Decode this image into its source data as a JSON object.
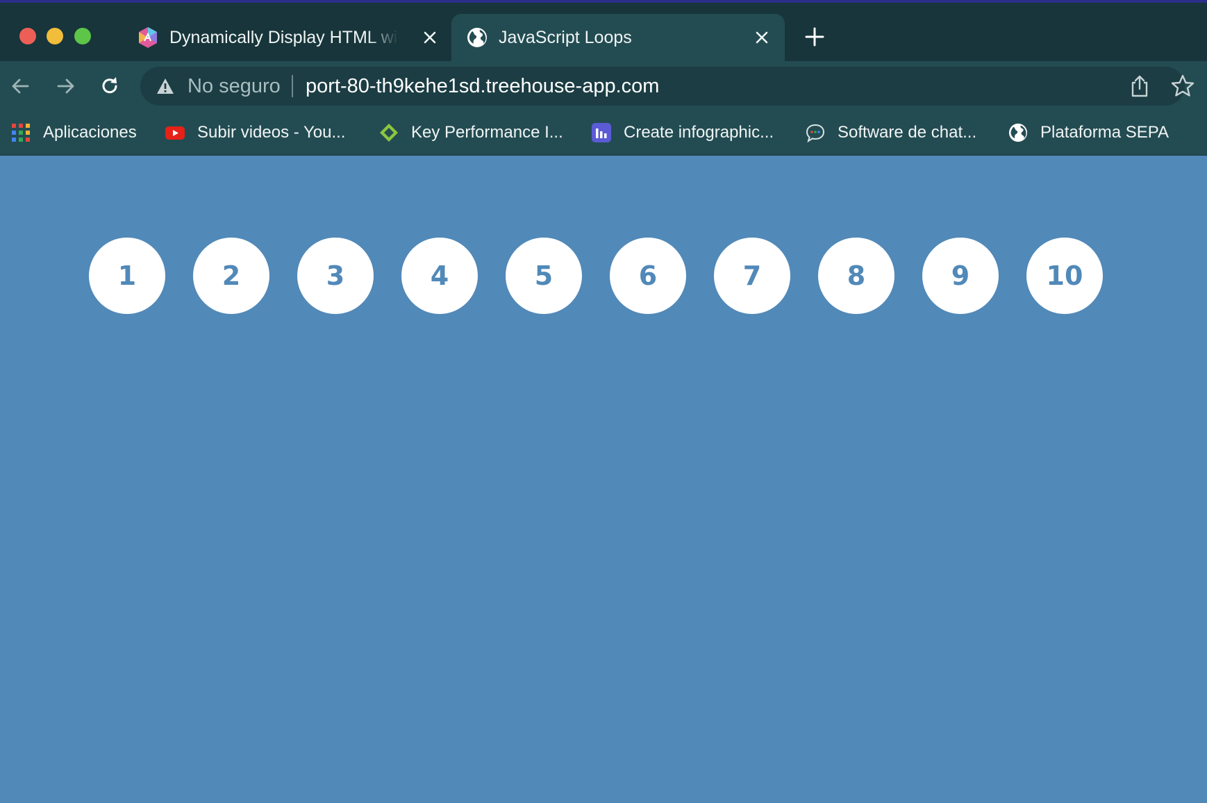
{
  "browser": {
    "tabs": [
      {
        "title": "Dynamically Display HTML with",
        "icon": "treehouse-icon",
        "active": false
      },
      {
        "title": "JavaScript Loops",
        "icon": "globe-icon",
        "active": true
      }
    ],
    "address_bar": {
      "security_label": "No seguro",
      "url": "port-80-th9kehe1sd.treehouse-app.com"
    },
    "bookmarks": [
      {
        "label": "Aplicaciones",
        "icon": "apps-grid-icon"
      },
      {
        "label": "Subir videos - You...",
        "icon": "youtube-icon"
      },
      {
        "label": "Key Performance I...",
        "icon": "diamond-logo-icon"
      },
      {
        "label": "Create infographic...",
        "icon": "bar-chart-icon"
      },
      {
        "label": "Software de chat...",
        "icon": "chat-bubble-icon"
      },
      {
        "label": "Plataforma SEPA",
        "icon": "globe-icon"
      }
    ]
  },
  "page": {
    "background_color": "#5189b8",
    "circles": [
      "1",
      "2",
      "3",
      "4",
      "5",
      "6",
      "7",
      "8",
      "9",
      "10"
    ]
  }
}
